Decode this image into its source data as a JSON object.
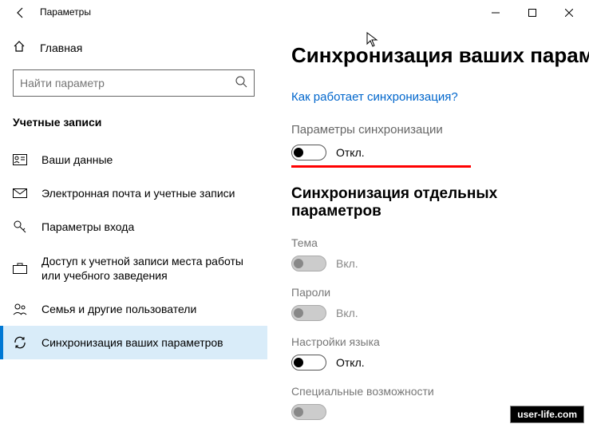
{
  "window": {
    "title": "Параметры"
  },
  "sidebar": {
    "home": "Главная",
    "search_placeholder": "Найти параметр",
    "section": "Учетные записи",
    "items": [
      {
        "label": "Ваши данные"
      },
      {
        "label": "Электронная почта и учетные записи"
      },
      {
        "label": "Параметры входа"
      },
      {
        "label": "Доступ к учетной записи места работы или учебного заведения"
      },
      {
        "label": "Семья и другие пользователи"
      },
      {
        "label": "Синхронизация ваших параметров"
      }
    ]
  },
  "main": {
    "heading": "Синхронизация ваших парамет",
    "help_link": "Как работает синхронизация?",
    "sync_label": "Параметры синхронизации",
    "sync_state": "Откл.",
    "sub_heading": "Синхронизация отдельных параметров",
    "subs": [
      {
        "label": "Тема",
        "state": "Вкл."
      },
      {
        "label": "Пароли",
        "state": "Вкл."
      },
      {
        "label": "Настройки языка",
        "state": "Откл."
      },
      {
        "label": "Специальные возможности",
        "state": ""
      }
    ]
  },
  "watermark": "user-life.com"
}
